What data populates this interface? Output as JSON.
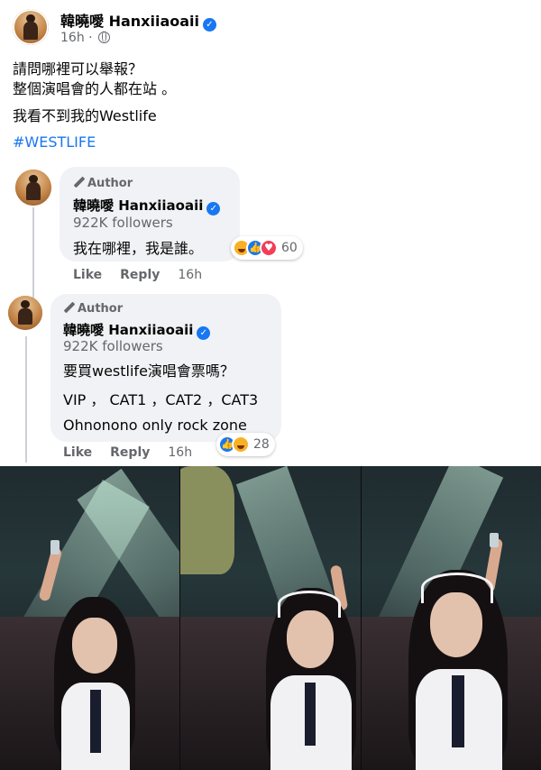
{
  "post": {
    "author": "韓曉噯 Hanxiiaoaii",
    "time": "16h ·",
    "lines": [
      "請問哪裡可以舉報？",
      "整個演唱會的人都在站 。",
      "我看不到我的Westlife"
    ],
    "hashtag": "#WESTLIFE"
  },
  "comments": [
    {
      "tag": "Author",
      "name": "韓曉噯 Hanxiiaoaii",
      "followers": "922K followers",
      "text": [
        "我在哪裡，我是誰。"
      ],
      "reaction_count": "60",
      "reactions": [
        "haha-icon",
        "like-icon",
        "love-icon"
      ],
      "actions": {
        "like": "Like",
        "reply": "Reply",
        "time": "16h"
      }
    },
    {
      "tag": "Author",
      "name": "韓曉噯 Hanxiiaoaii",
      "followers": "922K followers",
      "text": [
        "要買westlife演唱會票嗎？",
        "VIP ， CAT1 ，CAT2 ，CAT3",
        "Ohnonono only rock zone"
      ],
      "reaction_count": "28",
      "reactions": [
        "like-icon",
        "haha-icon"
      ],
      "actions": {
        "like": "Like",
        "reply": "Reply",
        "time": "16h"
      }
    }
  ],
  "colors": {
    "link": "#1877f2",
    "bubble": "#f0f2f5",
    "meta": "#65676b"
  }
}
